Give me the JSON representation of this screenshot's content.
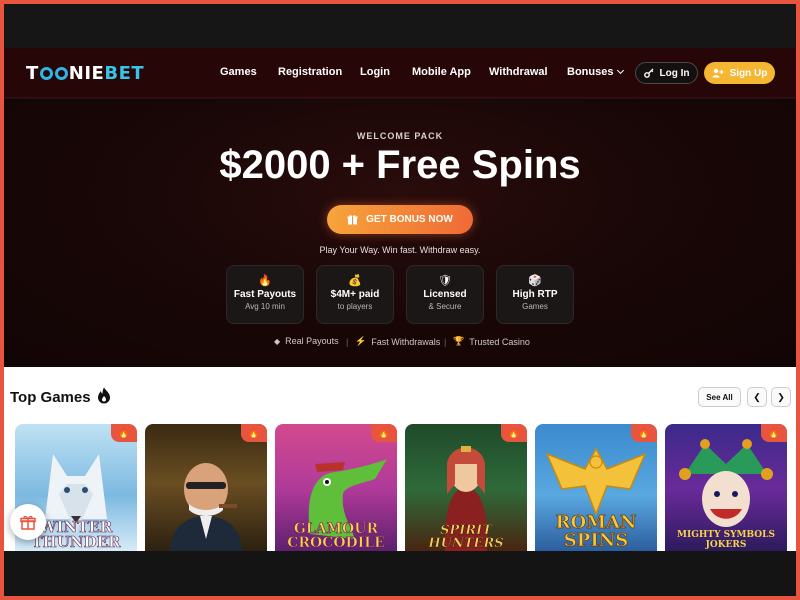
{
  "header": {
    "logo": {
      "pre": "T",
      "mid": "NIEBET",
      "bet_split": "NIE",
      "bet": "BET"
    },
    "nav": [
      {
        "label": "Games"
      },
      {
        "label": "Registration"
      },
      {
        "label": "Login"
      },
      {
        "label": "Mobile App"
      },
      {
        "label": "Withdrawal"
      },
      {
        "label": "Bonuses"
      }
    ],
    "login_label": "Log In",
    "signup_label": "Sign Up"
  },
  "hero": {
    "eyebrow": "WELCOME PACK",
    "headline": "$2000 + Free Spins",
    "cta_label": "GET BONUS NOW",
    "tagline": "Play Your Way. Win fast. Withdraw easy.",
    "features": [
      {
        "icon": "🔥",
        "title": "Fast Payouts",
        "sub": "Avg 10 min"
      },
      {
        "icon": "💰",
        "title": "$4M+ paid",
        "sub": "to players"
      },
      {
        "icon": "🛡",
        "title": "Licensed",
        "sub": "& Secure"
      },
      {
        "icon": "🎲",
        "title": "High RTP",
        "sub": "Games"
      }
    ],
    "trust": [
      {
        "icon": "◆",
        "label": "Real Payouts"
      },
      {
        "icon": "⚡",
        "label": "Fast Withdrawals"
      },
      {
        "icon": "🏆",
        "label": "Trusted Casino"
      }
    ],
    "separator": "|"
  },
  "games": {
    "title": "Top Games",
    "see_all": "See All",
    "prev": "❮",
    "next": "❯",
    "cards": [
      {
        "title": "WINTER\nTHUNDER"
      },
      {
        "title": ""
      },
      {
        "title": "GLAMOUR\nCROCODILE"
      },
      {
        "title": "SPIRIT\nHUNTERS"
      },
      {
        "title": "ROMAN\nSPINS"
      },
      {
        "title": "MIGHTY SYMBOLS\nJOKERS"
      }
    ],
    "hot_icon": "🔥"
  },
  "colors": {
    "accent": "#f5b632",
    "cta_start": "#f7a43a",
    "cta_end": "#f06a35",
    "header_bg": "#260606",
    "logo_bet": "#38c4e8",
    "hot_flag": "#e8553f"
  },
  "icons": {
    "login": "key-icon",
    "signup": "user-plus-icon",
    "cta": "gift-icon",
    "games_title": "fire-icon",
    "floating": "gift-icon"
  }
}
